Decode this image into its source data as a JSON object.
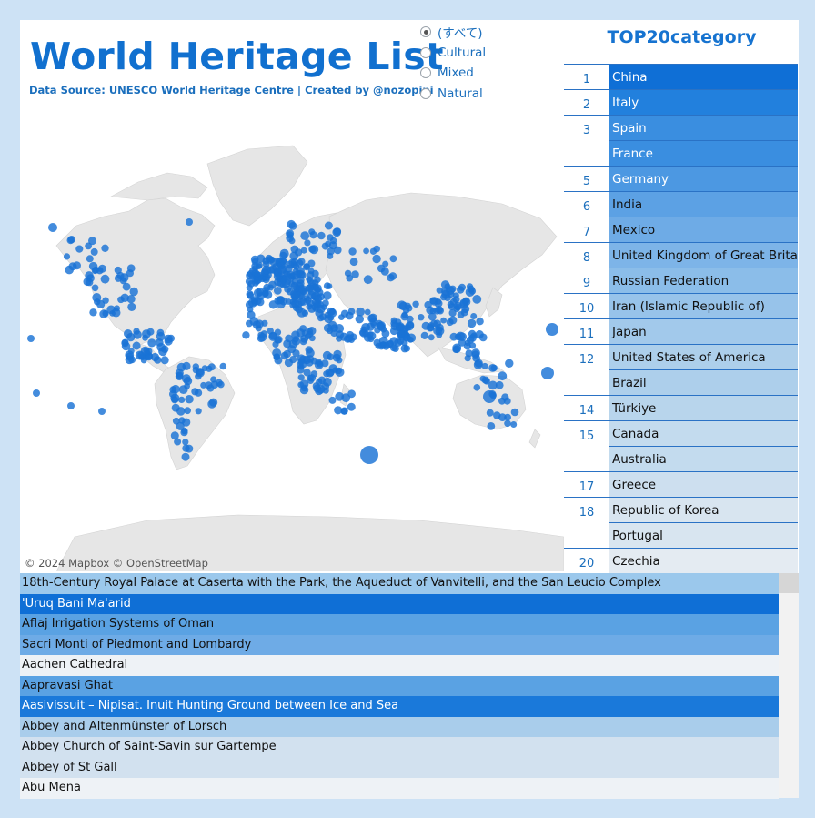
{
  "header": {
    "title": "World Heritage List",
    "source": "Data Source: UNESCO World Heritage Centre | Created by @nozopipi"
  },
  "filters": [
    {
      "label": "(すべて)",
      "selected": true
    },
    {
      "label": "Cultural",
      "selected": false
    },
    {
      "label": "Mixed",
      "selected": false
    },
    {
      "label": "Natural",
      "selected": false
    }
  ],
  "map": {
    "attribution": "© 2024 Mapbox  © OpenStreetMap",
    "dot_color": "#1a73d6"
  },
  "ranking": {
    "title": "TOP20category",
    "rows": [
      {
        "rank": "1",
        "name": "China",
        "bg": "#0f6fd6",
        "fg": "#ffffff"
      },
      {
        "rank": "2",
        "name": "Italy",
        "bg": "#2280dd",
        "fg": "#ffffff"
      },
      {
        "rank": "3",
        "name": "Spain",
        "bg": "#3a8ee0",
        "fg": "#ffffff"
      },
      {
        "rank": "",
        "name": "France",
        "bg": "#3a8ee0",
        "fg": "#ffffff"
      },
      {
        "rank": "5",
        "name": "Germany",
        "bg": "#4c98e2",
        "fg": "#ffffff"
      },
      {
        "rank": "6",
        "name": "India",
        "bg": "#5ca1e4",
        "fg": "#111111"
      },
      {
        "rank": "7",
        "name": "Mexico",
        "bg": "#6eabe6",
        "fg": "#111111"
      },
      {
        "rank": "8",
        "name": "United Kingdom of Great Britai",
        "bg": "#7db4e8",
        "fg": "#111111"
      },
      {
        "rank": "9",
        "name": "Russian Federation",
        "bg": "#8bbde9",
        "fg": "#111111"
      },
      {
        "rank": "10",
        "name": "Iran (Islamic Republic of)",
        "bg": "#97c3ea",
        "fg": "#111111"
      },
      {
        "rank": "11",
        "name": "Japan",
        "bg": "#a2c9eb",
        "fg": "#111111"
      },
      {
        "rank": "12",
        "name": "United States of America",
        "bg": "#adcfeb",
        "fg": "#111111"
      },
      {
        "rank": "",
        "name": "Brazil",
        "bg": "#adcfeb",
        "fg": "#111111"
      },
      {
        "rank": "14",
        "name": "Türkiye",
        "bg": "#b8d5ec",
        "fg": "#111111"
      },
      {
        "rank": "15",
        "name": "Canada",
        "bg": "#c3dbee",
        "fg": "#111111"
      },
      {
        "rank": "",
        "name": "Australia",
        "bg": "#c3dbee",
        "fg": "#111111"
      },
      {
        "rank": "17",
        "name": "Greece",
        "bg": "#cddfef",
        "fg": "#111111"
      },
      {
        "rank": "18",
        "name": "Republic of Korea",
        "bg": "#d8e5f0",
        "fg": "#111111"
      },
      {
        "rank": "",
        "name": "Portugal",
        "bg": "#d8e5f0",
        "fg": "#111111"
      },
      {
        "rank": "20",
        "name": "Czechia",
        "bg": "#e4ebf2",
        "fg": "#111111"
      }
    ]
  },
  "sites": [
    {
      "name": "18th-Century Royal Palace at Caserta with the Park, the Aqueduct of Vanvitelli, and the San Leucio Complex",
      "bg": "#9bc8ec",
      "fg": "#111111"
    },
    {
      "name": "'Uruq Bani Ma'arid",
      "bg": "#0f6fd6",
      "fg": "#ffffff"
    },
    {
      "name": "Aflaj Irrigation Systems of Oman",
      "bg": "#5aa2e3",
      "fg": "#111111"
    },
    {
      "name": "Sacri Monti of Piedmont and Lombardy",
      "bg": "#6eabe6",
      "fg": "#111111"
    },
    {
      "name": "Aachen Cathedral",
      "bg": "#eef2f6",
      "fg": "#111111"
    },
    {
      "name": "Aapravasi Ghat",
      "bg": "#5aa2e3",
      "fg": "#111111"
    },
    {
      "name": "Aasivissuit – Nipisat. Inuit Hunting Ground between Ice and Sea",
      "bg": "#1a79da",
      "fg": "#ffffff"
    },
    {
      "name": "Abbey and Altenmünster of Lorsch",
      "bg": "#a9cdeb",
      "fg": "#111111"
    },
    {
      "name": "Abbey Church of Saint-Savin sur Gartempe",
      "bg": "#d2e1ef",
      "fg": "#111111"
    },
    {
      "name": "Abbey of St Gall",
      "bg": "#d2e1ef",
      "fg": "#111111"
    },
    {
      "name": "Abu Mena",
      "bg": "#eef2f6",
      "fg": "#111111"
    }
  ]
}
